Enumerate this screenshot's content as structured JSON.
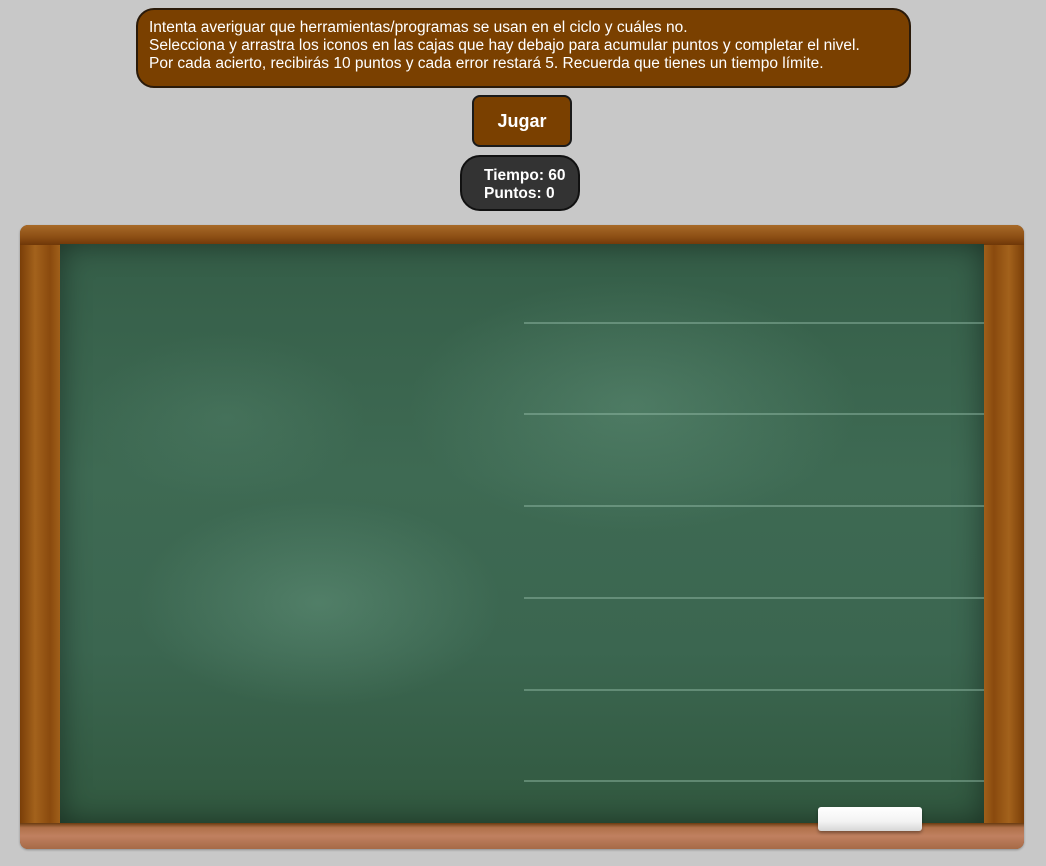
{
  "instructions": {
    "line1": "Intenta averiguar que herramientas/programas se usan en el ciclo y cuáles no.",
    "line2": "Selecciona y arrastra los iconos en las cajas que hay debajo para acumular puntos y completar el nivel.",
    "line3": "Por cada acierto, recibirás 10 puntos y cada error restará 5. Recuerda que tienes un tiempo límite."
  },
  "play_button": {
    "label": "Jugar"
  },
  "status": {
    "time_text": "Tiempo: 60",
    "points_text": "Puntos: 0"
  },
  "colors": {
    "accent_brown": "#7a4000",
    "background": "#c8c8c8",
    "status_bg": "#333333",
    "board_green": "#3e6a53"
  },
  "icons": {
    "eraser": "eraser-icon"
  }
}
